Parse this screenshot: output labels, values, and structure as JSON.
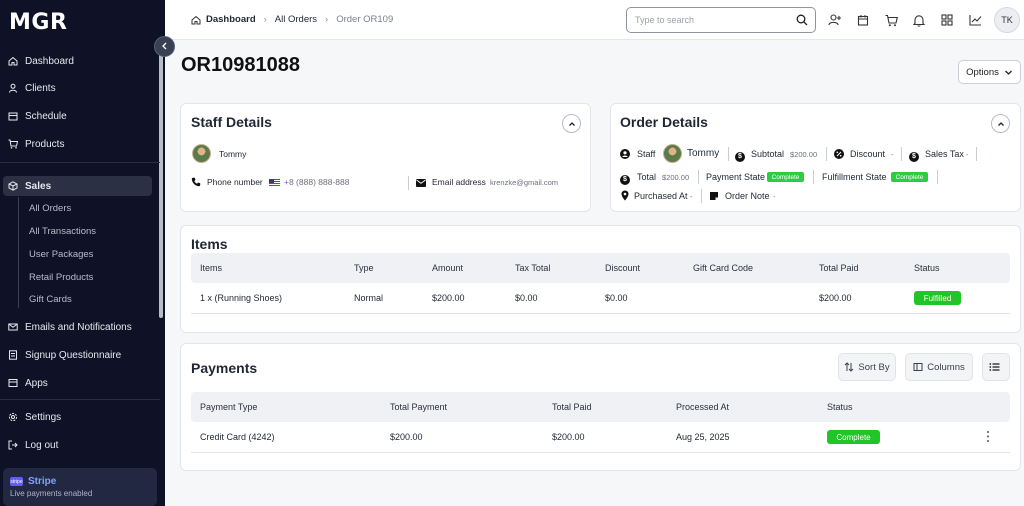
{
  "sidebar": {
    "logo": "MGR",
    "nav": [
      {
        "label": "Dashboard",
        "icon": "home-icon"
      },
      {
        "label": "Clients",
        "icon": "user-icon"
      },
      {
        "label": "Schedule",
        "icon": "calendar-icon"
      },
      {
        "label": "Products",
        "icon": "cart-icon"
      },
      {
        "label": "Sales",
        "icon": "box-icon"
      },
      {
        "label": "Emails and Notifications",
        "icon": "mail-icon"
      },
      {
        "label": "Signup Questionnaire",
        "icon": "form-icon"
      },
      {
        "label": "Apps",
        "icon": "apps-icon"
      },
      {
        "label": "Settings",
        "icon": "gear-icon"
      },
      {
        "label": "Log out",
        "icon": "logout-icon"
      }
    ],
    "sales_sub": [
      "All Orders",
      "All Transactions",
      "User Packages",
      "Retail Products",
      "Gift Cards"
    ],
    "stripe": {
      "name": "Stripe",
      "status": "Live payments enabled",
      "logo_text": "stripe"
    }
  },
  "topbar": {
    "breadcrumb": [
      "Dashboard",
      "All Orders",
      "Order OR109"
    ],
    "search_placeholder": "Type to search",
    "avatar_initials": "TK"
  },
  "page": {
    "title": "OR10981088",
    "options_label": "Options"
  },
  "staff": {
    "title": "Staff Details",
    "name": "Tommy",
    "phone_label": "Phone number",
    "phone": "+8 (888) 888-888",
    "email_label": "Email address",
    "email": "krenzke@gmail.com"
  },
  "order": {
    "title": "Order Details",
    "staff_label": "Staff",
    "staff_name": "Tommy",
    "subtotal_label": "Subtotal",
    "subtotal": "$200.00",
    "discount_label": "Discount",
    "discount": "-",
    "sales_tax_label": "Sales Tax",
    "sales_tax": "-",
    "total_label": "Total",
    "total": "$200.00",
    "payment_state_label": "Payment State",
    "payment_state": "Complete",
    "fulfillment_state_label": "Fulfillment State",
    "fulfillment_state": "Complete",
    "purchased_at_label": "Purchased At",
    "purchased_at": "-",
    "order_note_label": "Order Note",
    "order_note": "-"
  },
  "items": {
    "title": "Items",
    "headers": [
      "Items",
      "Type",
      "Amount",
      "Tax Total",
      "Discount",
      "Gift Card Code",
      "Total Paid",
      "Status"
    ],
    "rows": [
      {
        "item": "1 x (Running Shoes)",
        "type": "Normal",
        "amount": "$200.00",
        "tax_total": "$0.00",
        "discount": "$0.00",
        "gift_card_code": "",
        "total_paid": "$200.00",
        "status": "Fulfilled"
      }
    ]
  },
  "payments": {
    "title": "Payments",
    "sort_label": "Sort By",
    "columns_label": "Columns",
    "headers": [
      "Payment Type",
      "Total Payment",
      "Total Paid",
      "Processed At",
      "Status"
    ],
    "rows": [
      {
        "payment_type": "Credit Card (4242)",
        "total_payment": "$200.00",
        "total_paid": "$200.00",
        "processed_at": "Aug 25, 2025",
        "status": "Complete"
      }
    ]
  },
  "colors": {
    "sidebar_bg": "#0f1226",
    "success": "#22c528",
    "accent": "#635bff"
  }
}
